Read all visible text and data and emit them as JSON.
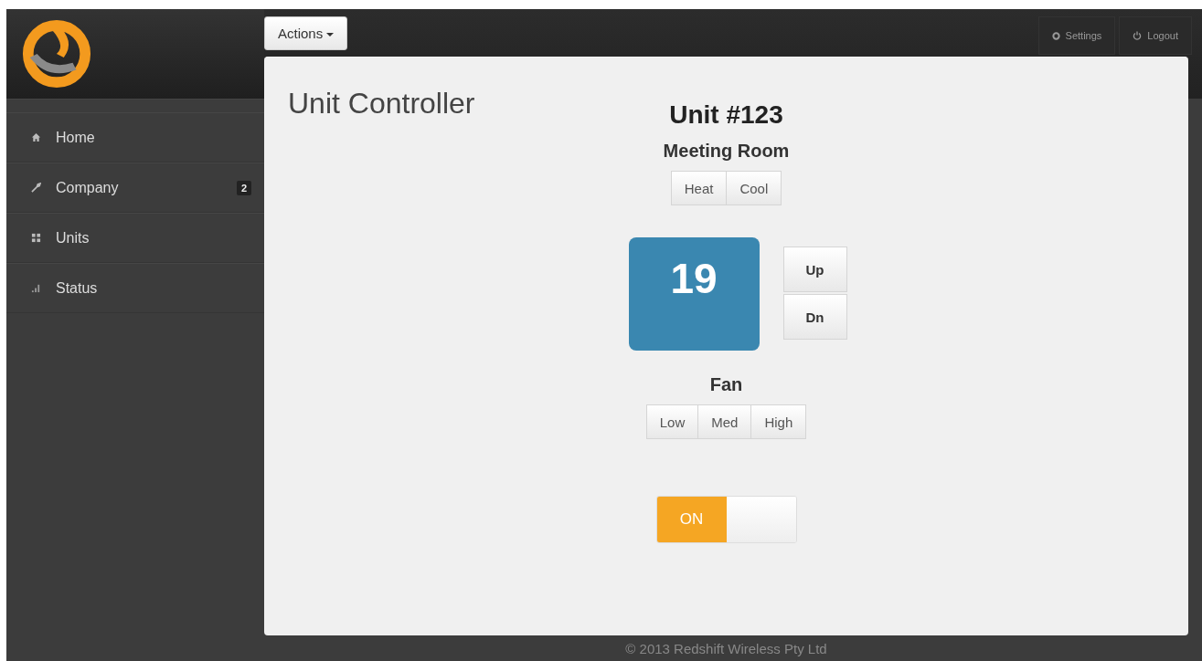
{
  "header": {
    "actions_button": "Actions",
    "settings_button": "Settings",
    "logout_button": "Logout"
  },
  "sidebar": {
    "items": [
      {
        "label": "Home"
      },
      {
        "label": "Company",
        "badge": "2"
      },
      {
        "label": "Units"
      },
      {
        "label": "Status"
      }
    ]
  },
  "page_title": "Unit Controller",
  "unit": {
    "title": "Unit #123",
    "room": "Meeting Room",
    "modes": [
      {
        "label": "Heat"
      },
      {
        "label": "Cool"
      }
    ],
    "temperature": "19",
    "up_button": "Up",
    "down_button": "Dn",
    "fan_label": "Fan",
    "fan_speeds": [
      {
        "label": "Low"
      },
      {
        "label": "Med"
      },
      {
        "label": "High"
      }
    ],
    "power": {
      "label": "ON",
      "on": true
    }
  },
  "footer": "© 2013 Redshift Wireless Pty Ltd"
}
